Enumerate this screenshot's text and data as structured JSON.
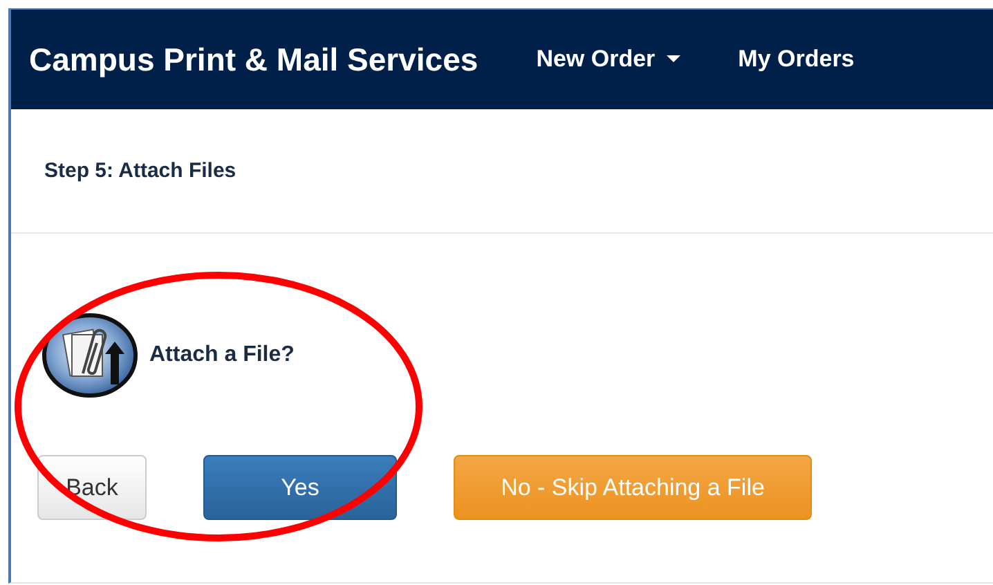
{
  "navbar": {
    "brand": "Campus Print & Mail Services",
    "items": [
      {
        "label": "New Order",
        "kind": "dropdown"
      },
      {
        "label": "My Orders",
        "kind": "link"
      }
    ]
  },
  "step": {
    "title": "Step 5: Attach Files"
  },
  "prompt": {
    "text": "Attach a File?"
  },
  "buttons": [
    {
      "label": "Back",
      "kind": "default"
    },
    {
      "label": "Yes",
      "kind": "primary"
    },
    {
      "label": "No - Skip Attaching a File",
      "kind": "warning"
    }
  ],
  "annotations": [
    {
      "kind": "ellipse"
    }
  ]
}
